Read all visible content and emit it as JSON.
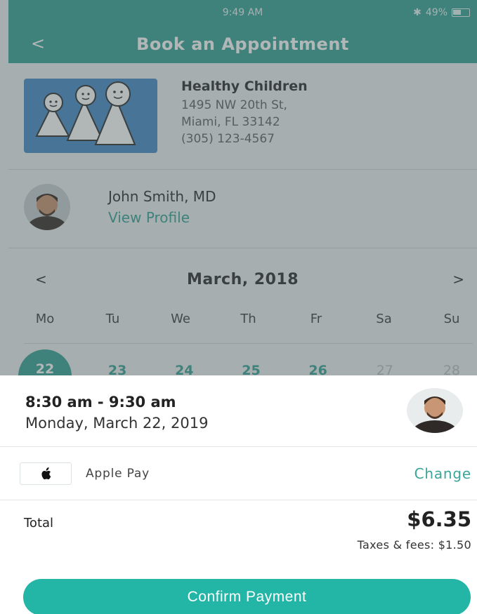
{
  "status_bar": {
    "time": "9:49 AM",
    "battery": "49%",
    "bluetooth_icon": "bluetooth-icon"
  },
  "nav": {
    "back": "<",
    "title": "Book an Appointment"
  },
  "clinic": {
    "name": "Healthy Children",
    "address_line1": "1495 NW 20th St,",
    "address_line2": "Miami, FL 33142",
    "phone": "(305) 123-4567"
  },
  "doctor": {
    "name": "John Smith, MD",
    "link": "View Profile"
  },
  "calendar": {
    "prev": "<",
    "next": ">",
    "month": "March, 2018",
    "weekdays": [
      "Mo",
      "Tu",
      "We",
      "Th",
      "Fr",
      "Sa",
      "Su"
    ],
    "days": [
      "22",
      "23",
      "24",
      "25",
      "26",
      "27",
      "28"
    ],
    "selected_index": 0,
    "disabled_indices": [
      5,
      6
    ]
  },
  "appointment": {
    "time": "8:30 am - 9:30 am",
    "date": "Monday, March 22, 2019"
  },
  "payment": {
    "method": "Apple Pay",
    "change": "Change",
    "icon": "apple-icon"
  },
  "totals": {
    "label": "Total",
    "amount": "$6.35",
    "taxes": "Taxes & fees: $1.50"
  },
  "confirm": {
    "label": "Confirm Payment"
  },
  "colors": {
    "accent": "#3aa598",
    "button": "#23b5a6",
    "clinic_logo_bg": "#4b8fc9"
  }
}
